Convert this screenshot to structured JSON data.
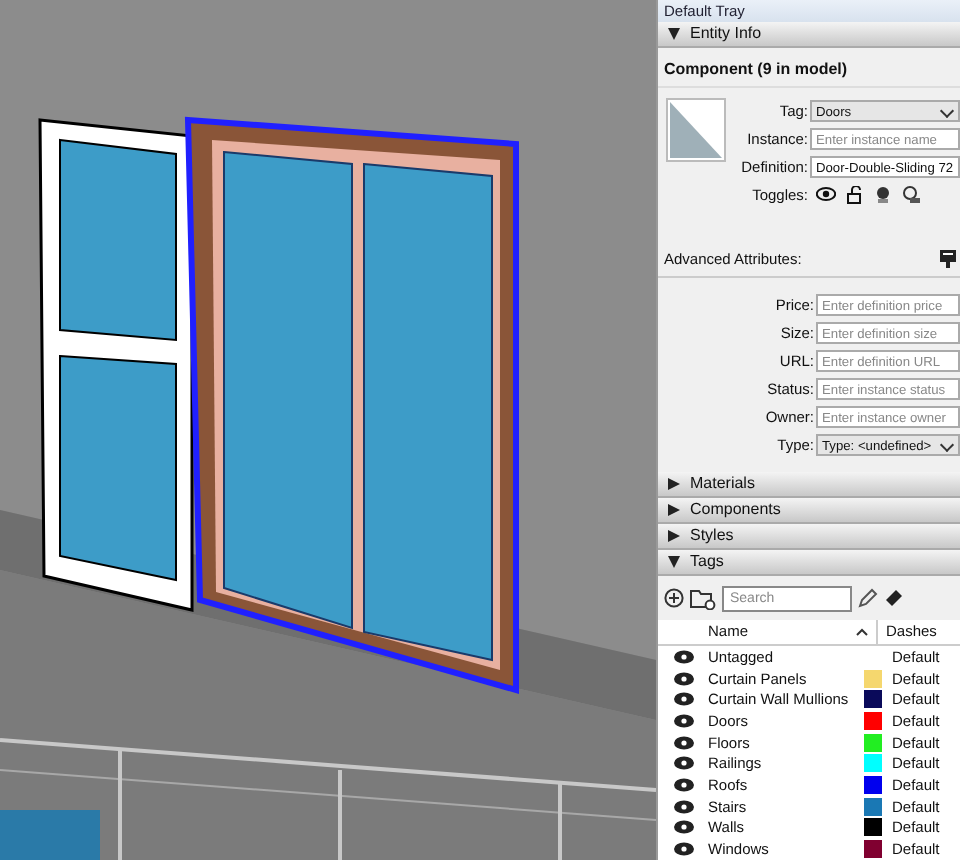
{
  "tray": {
    "title": "Default Tray"
  },
  "entity_info": {
    "header": "Entity Info",
    "expanded": true,
    "title": "Component (9 in model)",
    "fields": [
      {
        "kind": "select",
        "label": "Tag:",
        "value": "Doors"
      },
      {
        "kind": "input",
        "label": "Instance:",
        "placeholder": "Enter instance name"
      },
      {
        "kind": "input",
        "label": "Definition:",
        "value": "Door-Double-Sliding 72"
      }
    ],
    "toggles_label": "Toggles:",
    "advanced_label": "Advanced Attributes:",
    "attributes": [
      {
        "kind": "input",
        "label": "Price:",
        "placeholder": "Enter definition price"
      },
      {
        "kind": "input",
        "label": "Size:",
        "placeholder": "Enter definition size"
      },
      {
        "kind": "input",
        "label": "URL:",
        "placeholder": "Enter definition URL"
      },
      {
        "kind": "input",
        "label": "Status:",
        "placeholder": "Enter instance status"
      },
      {
        "kind": "input",
        "label": "Owner:",
        "placeholder": "Enter instance owner"
      },
      {
        "kind": "select",
        "label": "Type:",
        "value": "Type: <undefined>"
      }
    ]
  },
  "sections": [
    {
      "label": "Materials",
      "expanded": false
    },
    {
      "label": "Components",
      "expanded": false
    },
    {
      "label": "Styles",
      "expanded": false
    },
    {
      "label": "Tags",
      "expanded": true
    }
  ],
  "tags": {
    "search_placeholder": "Search",
    "columns": [
      "Name",
      "Dashes"
    ],
    "rows": [
      {
        "name": "Untagged",
        "visible": true,
        "dashes": "Default"
      },
      {
        "name": "Curtain Panels",
        "visible": true,
        "color": "#f5d76e",
        "dashes": "Default"
      },
      {
        "name": "Curtain Wall Mullions",
        "visible": true,
        "color": "#0a0a5a",
        "dashes": "Default"
      },
      {
        "name": "Doors",
        "visible": true,
        "color": "#ff0000",
        "dashes": "Default"
      },
      {
        "name": "Floors",
        "visible": true,
        "color": "#22ee22",
        "dashes": "Default"
      },
      {
        "name": "Railings",
        "visible": true,
        "color": "#00ffff",
        "dashes": "Default"
      },
      {
        "name": "Roofs",
        "visible": true,
        "color": "#0000ee",
        "dashes": "Default"
      },
      {
        "name": "Stairs",
        "visible": true,
        "color": "#1a78b4",
        "dashes": "Default"
      },
      {
        "name": "Walls",
        "visible": true,
        "color": "#000000",
        "dashes": "Default"
      },
      {
        "name": "Windows",
        "visible": true,
        "color": "#800030",
        "dashes": "Default"
      }
    ]
  }
}
